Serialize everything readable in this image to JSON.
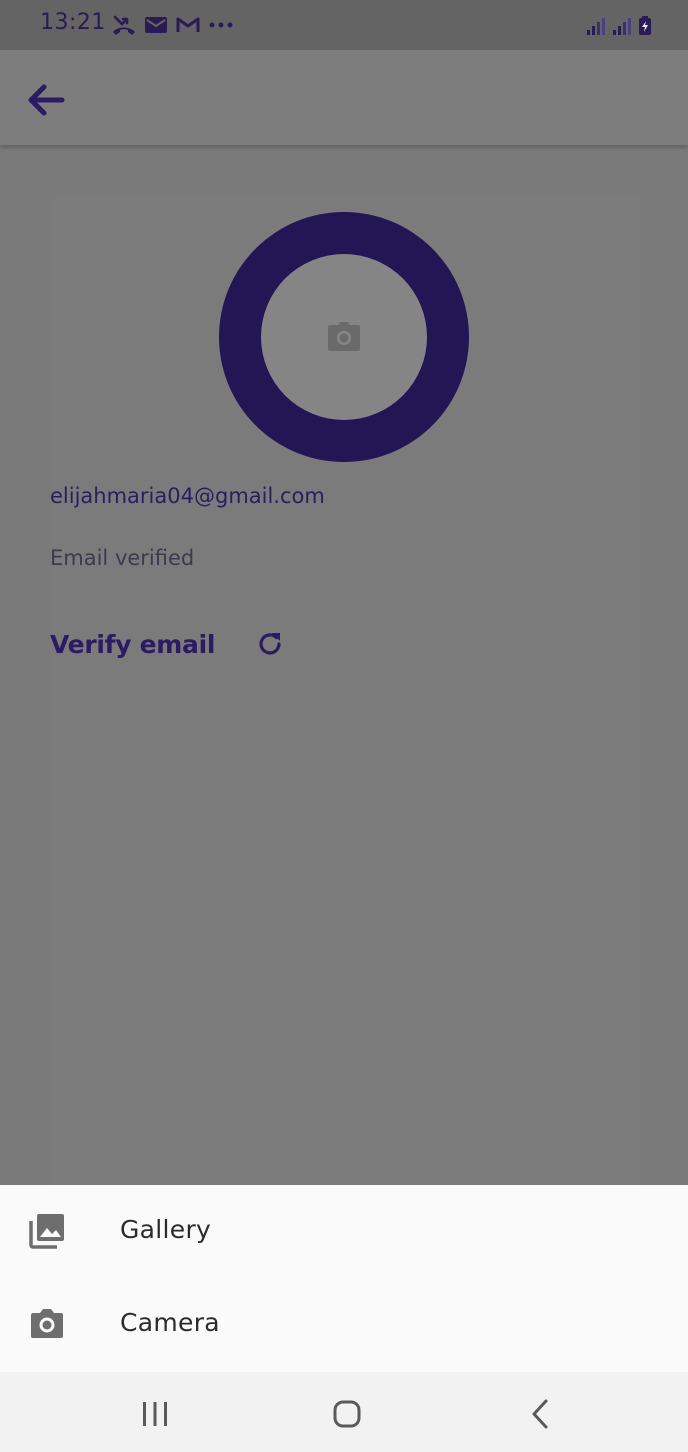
{
  "status_bar": {
    "time": "13:21",
    "left_icons": [
      "missed-call-icon",
      "mail-icon",
      "gmail-icon",
      "more-dots-icon"
    ],
    "right_icons": [
      "signal-icon",
      "signal-icon",
      "battery-charging-icon"
    ]
  },
  "app_bar": {
    "back_icon": "arrow-left-icon"
  },
  "profile": {
    "avatar_icon": "camera-icon",
    "email": "elijahmaria04@gmail.com",
    "email_status": "Email verified",
    "verify_label": "Verify email",
    "verify_icon": "refresh-icon"
  },
  "bottom_sheet": {
    "items": [
      {
        "label": "Gallery",
        "icon": "gallery-icon"
      },
      {
        "label": "Camera",
        "icon": "camera-icon"
      }
    ]
  },
  "nav_bar": {
    "icons": [
      "recent-apps-icon",
      "home-icon",
      "back-icon"
    ]
  },
  "colors": {
    "accent": "#231655",
    "scrim": "#7a7a7a",
    "sheet": "#fafafa"
  }
}
